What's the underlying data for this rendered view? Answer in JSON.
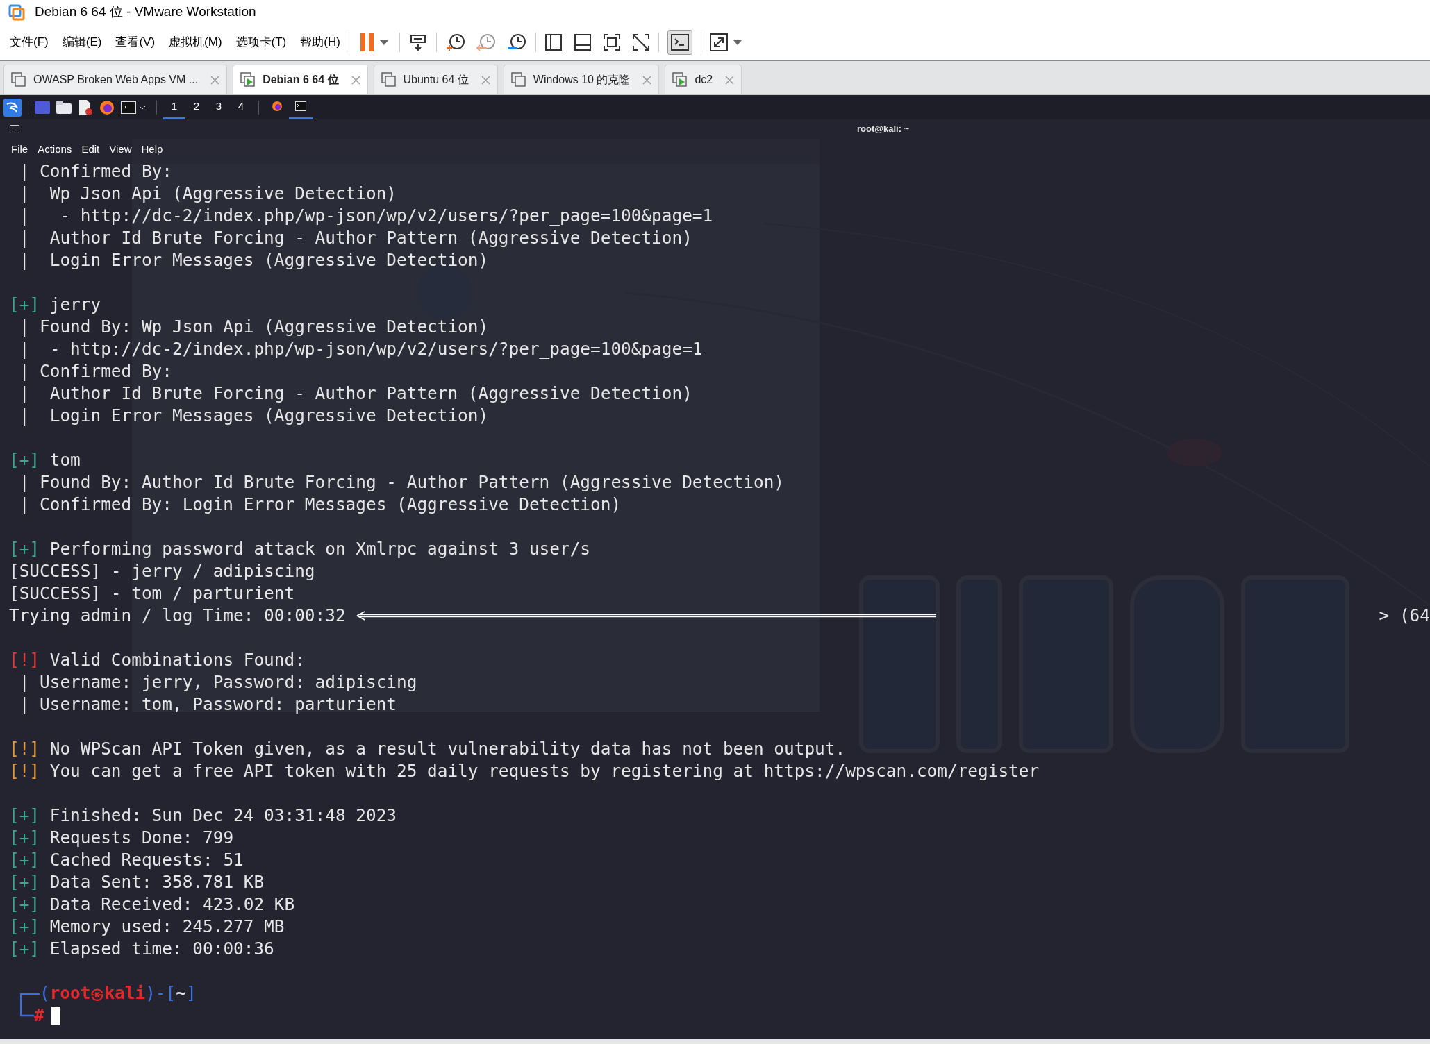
{
  "window": {
    "title": "Debian 6 64 位 - VMware Workstation"
  },
  "menu": [
    "文件(F)",
    "编辑(E)",
    "查看(V)",
    "虚拟机(M)",
    "选项卡(T)",
    "帮助(H)"
  ],
  "toolbar": {
    "console_view_on": true
  },
  "tabs": [
    {
      "label": "OWASP Broken Web Apps VM ...",
      "running": false,
      "selected": false
    },
    {
      "label": "Debian 6 64 位",
      "running": true,
      "selected": true
    },
    {
      "label": "Ubuntu 64 位",
      "running": false,
      "selected": false
    },
    {
      "label": "Windows 10 的克隆",
      "running": false,
      "selected": false
    },
    {
      "label": "dc2",
      "running": true,
      "selected": false
    }
  ],
  "guest_panel": {
    "workspaces": [
      {
        "label": "1",
        "selected": true
      },
      {
        "label": "2",
        "selected": false
      },
      {
        "label": "3",
        "selected": false
      },
      {
        "label": "4",
        "selected": false
      }
    ],
    "tasks": [
      {
        "kind": "browser",
        "selected": false
      },
      {
        "kind": "terminal",
        "selected": true
      }
    ]
  },
  "terminal": {
    "title": "root@kali: ~",
    "menu": [
      "File",
      "Actions",
      "Edit",
      "View",
      "Help"
    ],
    "lines": [
      {
        "kind": "text",
        "text": " | Confirmed By:"
      },
      {
        "kind": "text",
        "text": " |  Wp Json Api (Aggressive Detection)"
      },
      {
        "kind": "text",
        "text": " |   - http://dc-2/index.php/wp-json/wp/v2/users/?per_page=100&page=1"
      },
      {
        "kind": "text",
        "text": " |  Author Id Brute Forcing - Author Pattern (Aggressive Detection)"
      },
      {
        "kind": "text",
        "text": " |  Login Error Messages (Aggressive Detection)"
      },
      {
        "kind": "blank"
      },
      {
        "kind": "text",
        "prefix": {
          "text": "[+]",
          "kind": "info"
        },
        "text": " jerry"
      },
      {
        "kind": "text",
        "text": " | Found By: Wp Json Api (Aggressive Detection)"
      },
      {
        "kind": "text",
        "text": " |  - http://dc-2/index.php/wp-json/wp/v2/users/?per_page=100&page=1"
      },
      {
        "kind": "text",
        "text": " | Confirmed By:"
      },
      {
        "kind": "text",
        "text": " |  Author Id Brute Forcing - Author Pattern (Aggressive Detection)"
      },
      {
        "kind": "text",
        "text": " |  Login Error Messages (Aggressive Detection)"
      },
      {
        "kind": "blank"
      },
      {
        "kind": "text",
        "prefix": {
          "text": "[+]",
          "kind": "info"
        },
        "text": " tom"
      },
      {
        "kind": "text",
        "text": " | Found By: Author Id Brute Forcing - Author Pattern (Aggressive Detection)"
      },
      {
        "kind": "text",
        "text": " | Confirmed By: Login Error Messages (Aggressive Detection)"
      },
      {
        "kind": "blank"
      },
      {
        "kind": "text",
        "prefix": {
          "text": "[+]",
          "kind": "info"
        },
        "text": " Performing password attack on Xmlrpc against 3 user/s"
      },
      {
        "kind": "text",
        "text": "[SUCCESS] - jerry / adipiscing"
      },
      {
        "kind": "text",
        "text": "[SUCCESS] - tom / parturient"
      },
      {
        "kind": "progress",
        "text": "Trying admin / log Time: 00:00:32",
        "end_text": "> (64"
      },
      {
        "kind": "blank"
      },
      {
        "kind": "text",
        "prefix": {
          "text": "[!]",
          "kind": "error"
        },
        "text": " Valid Combinations Found:"
      },
      {
        "kind": "text",
        "text": " | Username: jerry, Password: adipiscing"
      },
      {
        "kind": "text",
        "text": " | Username: tom, Password: parturient"
      },
      {
        "kind": "blank"
      },
      {
        "kind": "text",
        "prefix": {
          "text": "[!]",
          "kind": "warning"
        },
        "text": " No WPScan API Token given, as a result vulnerability data has not been output."
      },
      {
        "kind": "text",
        "prefix": {
          "text": "[!]",
          "kind": "warning"
        },
        "text": " You can get a free API token with 25 daily requests by registering at https://wpscan.com/register"
      },
      {
        "kind": "blank"
      },
      {
        "kind": "text",
        "prefix": {
          "text": "[+]",
          "kind": "info"
        },
        "text": " Finished: Sun Dec 24 03:31:48 2023"
      },
      {
        "kind": "text",
        "prefix": {
          "text": "[+]",
          "kind": "info"
        },
        "text": " Requests Done: 799"
      },
      {
        "kind": "text",
        "prefix": {
          "text": "[+]",
          "kind": "info"
        },
        "text": " Cached Requests: 51"
      },
      {
        "kind": "text",
        "prefix": {
          "text": "[+]",
          "kind": "info"
        },
        "text": " Data Sent: 358.781 KB"
      },
      {
        "kind": "text",
        "prefix": {
          "text": "[+]",
          "kind": "info"
        },
        "text": " Data Received: 423.02 KB"
      },
      {
        "kind": "text",
        "prefix": {
          "text": "[+]",
          "kind": "info"
        },
        "text": " Memory used: 245.277 MB"
      },
      {
        "kind": "text",
        "prefix": {
          "text": "[+]",
          "kind": "info"
        },
        "text": " Elapsed time: 00:00:36"
      },
      {
        "kind": "blank"
      },
      {
        "kind": "prompt",
        "open": "(",
        "user": "root",
        "at": "㉿",
        "host": "kali",
        "mid": ")-[",
        "dir": "~",
        "close": "]"
      },
      {
        "kind": "input",
        "symbol": "#",
        "cursor": true
      }
    ]
  }
}
